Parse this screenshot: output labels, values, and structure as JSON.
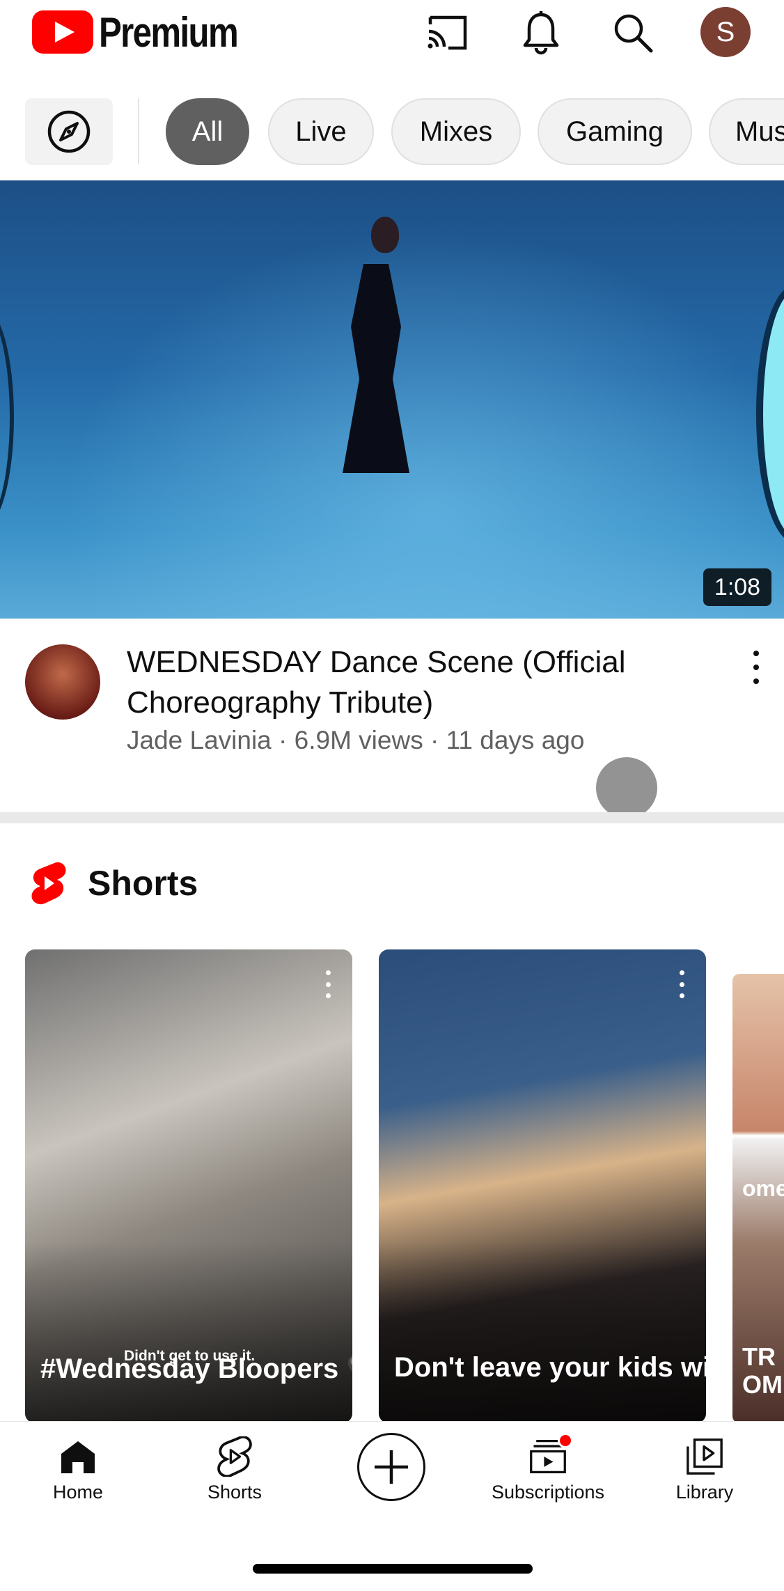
{
  "header": {
    "logo_text": "Premium",
    "icons": [
      "cast-icon",
      "bell-icon",
      "search-icon"
    ],
    "avatar_letter": "S",
    "avatar_color": "#7b3f32"
  },
  "chips": {
    "explore_icon": "compass-icon",
    "items": [
      {
        "label": "All",
        "active": true
      },
      {
        "label": "Live",
        "active": false
      },
      {
        "label": "Mixes",
        "active": false
      },
      {
        "label": "Gaming",
        "active": false
      },
      {
        "label": "Mus",
        "active": false
      }
    ]
  },
  "featured_video": {
    "duration": "1:08",
    "title": "WEDNESDAY Dance Scene (Official Choreography Tribute)",
    "meta": "Jade Lavinia · 6.9M views · 11 days ago"
  },
  "shorts": {
    "section_title": "Shorts",
    "brand_color": "#ff0000",
    "items": [
      {
        "caption": "#Wednesday Bloopers 🖤",
        "overlay_text": "Didn't get to use it."
      },
      {
        "caption": "Don't leave your kids with Aurora",
        "overlay_text": ""
      },
      {
        "caption": "TR OM",
        "overlay_text": "ome"
      }
    ]
  },
  "bottom_nav": {
    "items": [
      {
        "label": "Home",
        "icon": "home-icon"
      },
      {
        "label": "Shorts",
        "icon": "shorts-icon"
      },
      {
        "label": "",
        "icon": "create-plus-icon"
      },
      {
        "label": "Subscriptions",
        "icon": "subscriptions-icon"
      },
      {
        "label": "Library",
        "icon": "library-icon"
      }
    ]
  }
}
